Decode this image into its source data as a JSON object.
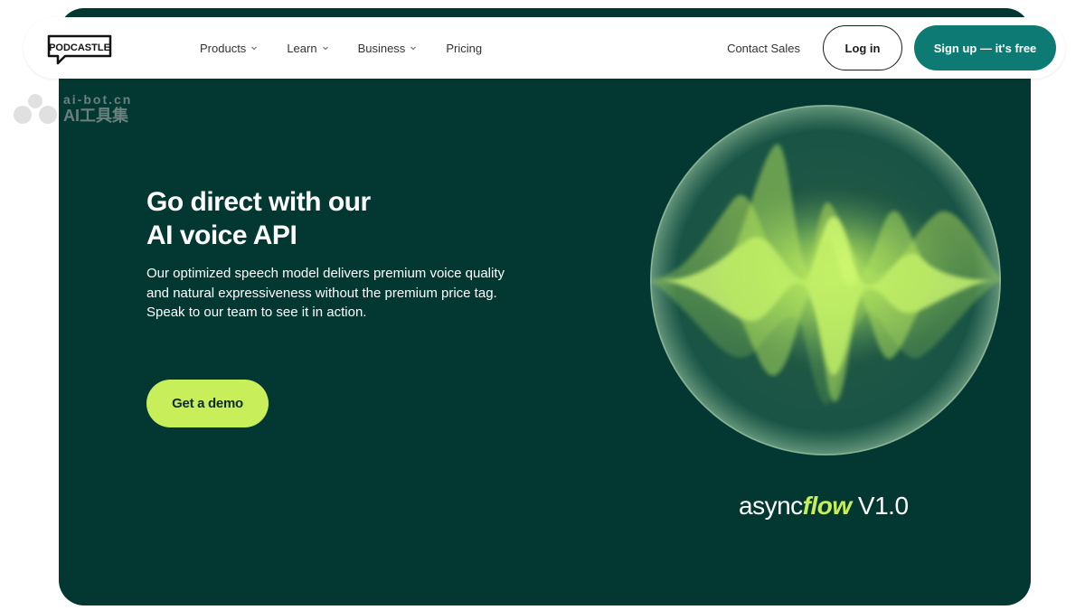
{
  "brand": {
    "logo_text": "PODCASTLE"
  },
  "nav": {
    "items": [
      {
        "label": "Products",
        "has_dropdown": true
      },
      {
        "label": "Learn",
        "has_dropdown": true
      },
      {
        "label": "Business",
        "has_dropdown": true
      },
      {
        "label": "Pricing",
        "has_dropdown": false
      }
    ],
    "contact_label": "Contact Sales",
    "login_label": "Log in",
    "signup_label": "Sign up — it's free"
  },
  "watermark": {
    "top": "ai-bot.cn",
    "bottom": "AI工具集"
  },
  "hero": {
    "headline_line1": "Go direct with our",
    "headline_line2": "AI voice API",
    "description": "Our optimized speech model delivers premium voice quality and natural expressiveness without the premium price tag. Speak to our team to see it in action.",
    "cta_label": "Get a demo",
    "version_prefix": "async",
    "version_accent": "flow",
    "version_suffix": " V1.0"
  },
  "colors": {
    "hero_bg": "#033832",
    "accent_lime": "#c8ef5a",
    "signup_teal": "#0d7a74"
  }
}
